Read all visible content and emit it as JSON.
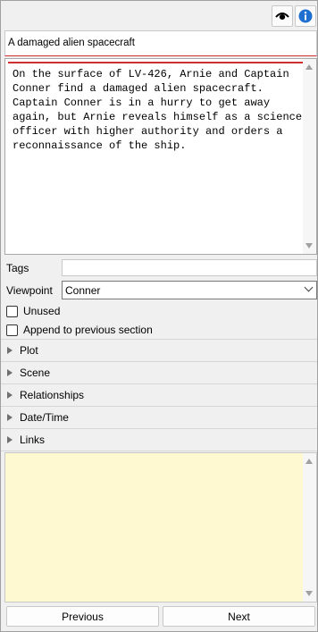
{
  "toolbar": {
    "icons": [
      "eye-icon",
      "info-icon"
    ],
    "accent": "#1e6fd0"
  },
  "scene": {
    "title": "A damaged alien spacecraft",
    "description": "On the surface of LV-426, Arnie and Captain Conner find a damaged alien spacecraft. Captain Conner is in a hurry to get away again, but Arnie reveals himself as a science officer with higher authority and orders a reconnaissance of the ship."
  },
  "fields": {
    "tags_label": "Tags",
    "tags_value": "",
    "viewpoint_label": "Viewpoint",
    "viewpoint_value": "Conner",
    "unused_label": "Unused",
    "append_label": "Append to previous section"
  },
  "sections": [
    {
      "label": "Plot"
    },
    {
      "label": "Scene"
    },
    {
      "label": "Relationships"
    },
    {
      "label": "Date/Time"
    },
    {
      "label": "Links"
    }
  ],
  "notes": {
    "value": "",
    "background": "#fff9d2"
  },
  "nav": {
    "previous": "Previous",
    "next": "Next"
  }
}
